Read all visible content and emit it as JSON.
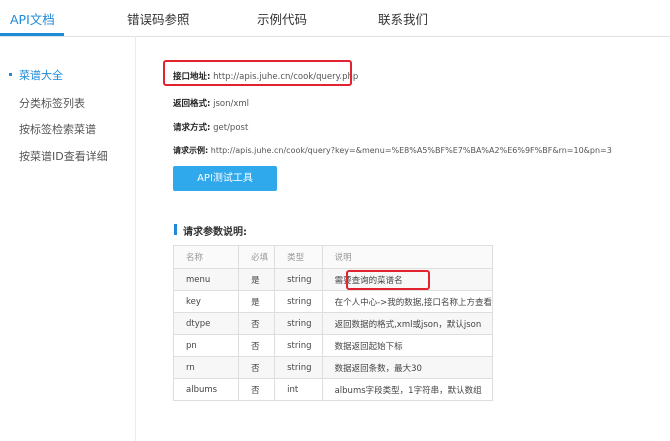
{
  "tabs": [
    {
      "label": "API文档",
      "active": true
    },
    {
      "label": "错误码参照",
      "active": false
    },
    {
      "label": "示例代码",
      "active": false
    },
    {
      "label": "联系我们",
      "active": false
    }
  ],
  "sidebar": {
    "items": [
      {
        "label": "菜谱大全",
        "active": true
      },
      {
        "label": "分类标签列表",
        "active": false
      },
      {
        "label": "按标签检索菜谱",
        "active": false
      },
      {
        "label": "按菜谱ID查看详细",
        "active": false
      }
    ]
  },
  "api": {
    "url_label": "接口地址:",
    "url_value": "http://apis.juhe.cn/cook/query.php",
    "format_label": "返回格式:",
    "format_value": "json/xml",
    "method_label": "请求方式:",
    "method_value": "get/post",
    "example_label": "请求示例:",
    "example_value": "http://apis.juhe.cn/cook/query?key=&menu=%E8%A5%BF%E7%BA%A2%E6%9F%BF&rn=10&pn=3",
    "test_button": "API测试工具"
  },
  "params": {
    "section_title": "请求参数说明:",
    "headers": [
      "名称",
      "必填",
      "类型",
      "说明"
    ],
    "rows": [
      [
        "menu",
        "是",
        "string",
        "需要查询的菜谱名"
      ],
      [
        "key",
        "是",
        "string",
        "在个人中心->我的数据,接口名称上方查看"
      ],
      [
        "dtype",
        "否",
        "string",
        "返回数据的格式,xml或json，默认json"
      ],
      [
        "pn",
        "否",
        "string",
        "数据返回起始下标"
      ],
      [
        "rn",
        "否",
        "string",
        "数据返回条数，最大30"
      ],
      [
        "albums",
        "否",
        "int",
        "albums字段类型，1字符串，默认数组"
      ]
    ]
  },
  "colors": {
    "accent": "#1f8ad8",
    "button": "#2fa8ec",
    "highlight_box": "#e0232e"
  }
}
